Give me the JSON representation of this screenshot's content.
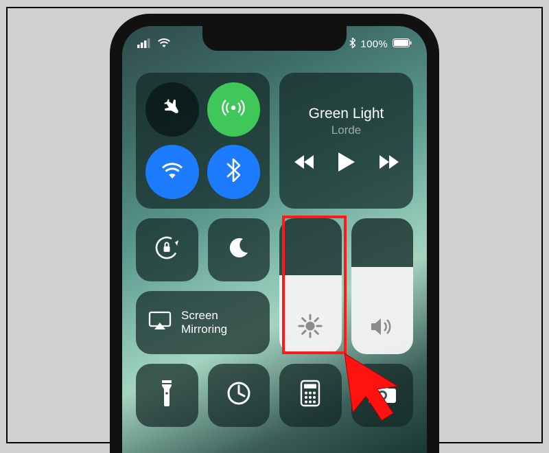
{
  "status": {
    "bluetooth_label": "100%",
    "battery_pct": 100
  },
  "now_playing": {
    "title": "Green Light",
    "artist": "Lorde"
  },
  "screen_mirroring": {
    "line1": "Screen",
    "line2": "Mirroring"
  },
  "sliders": {
    "brightness_pct": 58,
    "volume_pct": 64
  },
  "icons": {
    "airplane": "airplane-icon",
    "cellular": "cellular-antenna-icon",
    "wifi": "wifi-icon",
    "bluetooth": "bluetooth-icon",
    "orientation_lock": "orientation-lock-icon",
    "dnd": "moon-icon",
    "airplay": "airplay-icon",
    "brightness": "sun-icon",
    "volume": "speaker-icon",
    "flashlight": "flashlight-icon",
    "timer": "timer-icon",
    "calculator": "calculator-icon",
    "camera": "camera-icon"
  },
  "annotation": {
    "highlight_target": "brightness-slider"
  }
}
